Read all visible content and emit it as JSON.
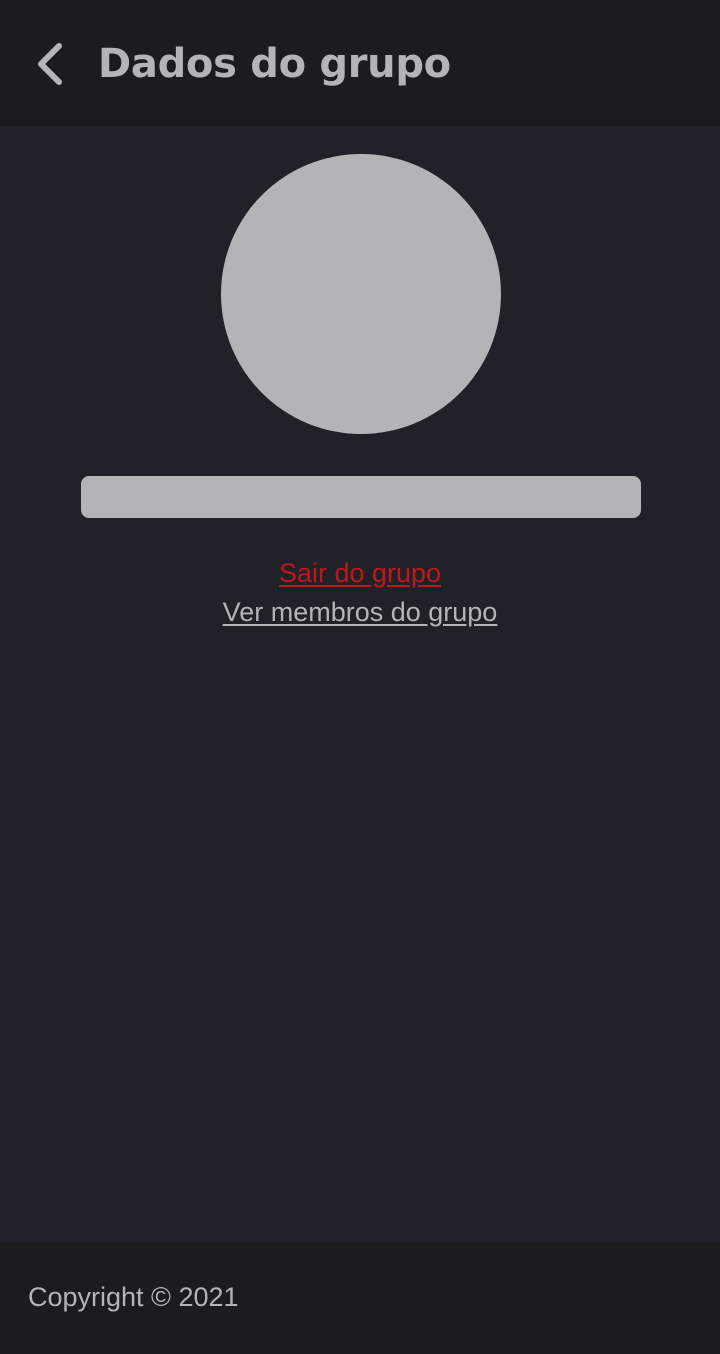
{
  "header": {
    "back_icon": "chevron-left-icon",
    "title": "Dados do grupo"
  },
  "group": {
    "avatar_color": "#b3b4b8",
    "name_placeholder_color": "#b3b4b8"
  },
  "actions": {
    "leave_label": "Sair do grupo",
    "members_label": "Ver membros do grupo"
  },
  "footer": {
    "copyright": "Copyright © 2021"
  },
  "colors": {
    "background": "#202129",
    "bars": "#1b1b20",
    "text": "#b3b4b8",
    "danger": "#c0171b"
  }
}
